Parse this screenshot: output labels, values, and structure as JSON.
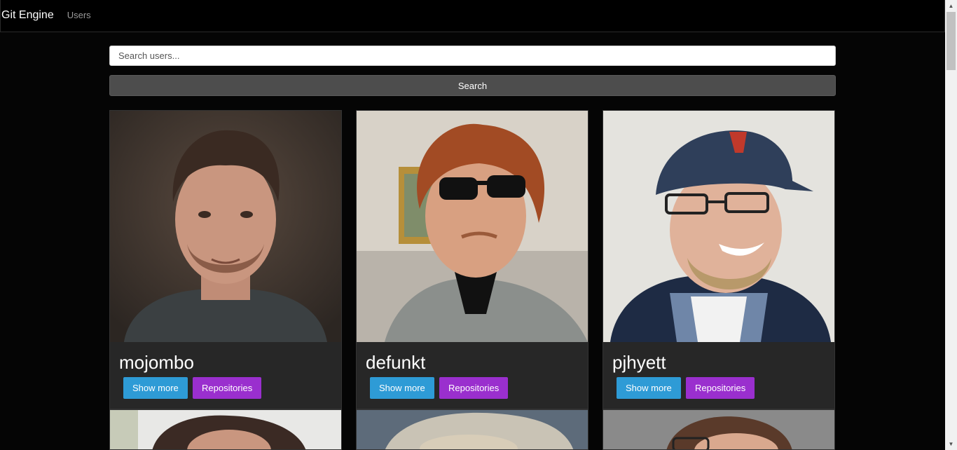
{
  "navbar": {
    "brand": "Git Engine",
    "links": [
      "Users"
    ]
  },
  "search": {
    "placeholder": "Search users...",
    "value": "",
    "button_label": "Search"
  },
  "users": [
    {
      "login": "mojombo",
      "show_more_label": "Show more",
      "repos_label": "Repositories"
    },
    {
      "login": "defunkt",
      "show_more_label": "Show more",
      "repos_label": "Repositories"
    },
    {
      "login": "pjhyett",
      "show_more_label": "Show more",
      "repos_label": "Repositories"
    }
  ],
  "colors": {
    "show_more": "#2e9bd6",
    "repositories": "#9a2fce",
    "card_bg": "#272727",
    "page_bg": "#050505"
  }
}
